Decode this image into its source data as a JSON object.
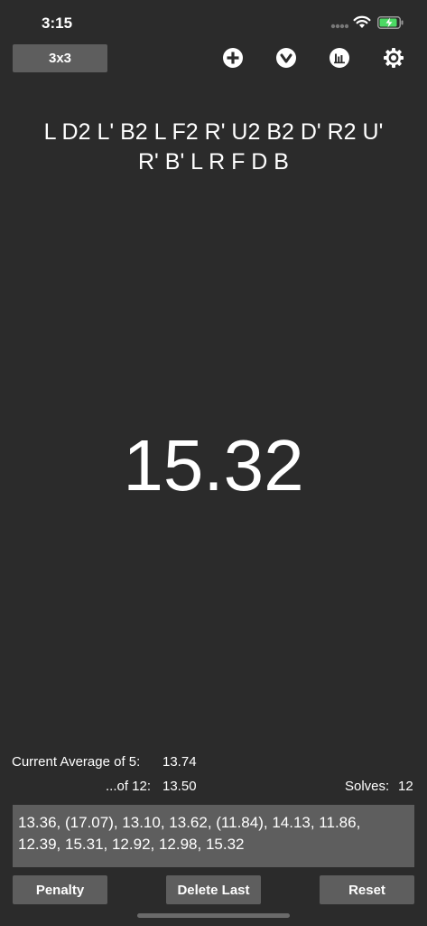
{
  "status_bar": {
    "time": "3:15"
  },
  "toolbar": {
    "puzzle_label": "3x3"
  },
  "scramble": {
    "line1": "L D2 L' B2 L F2 R' U2 B2 D' R2 U'",
    "line2": "R' B' L R F D B"
  },
  "timer": {
    "value": "15.32"
  },
  "stats": {
    "ao5_label": "Current Average of 5:",
    "ao5_value": "13.74",
    "ao12_label": "...of 12:",
    "ao12_value": "13.50",
    "solves_label": "Solves:",
    "solves_value": "12"
  },
  "times": {
    "line1": "13.36, (17.07), 13.10, 13.62, (11.84), 14.13, 11.86,",
    "line2": "12.39, 15.31, 12.92, 12.98, 15.32"
  },
  "actions": {
    "penalty_label": "Penalty",
    "delete_label": "Delete Last",
    "reset_label": "Reset"
  },
  "colors": {
    "background": "#2b2b2b",
    "button": "#5e5e5e",
    "battery": "#4cd964"
  },
  "icons": [
    "signal-icon",
    "wifi-icon",
    "battery-charging-icon",
    "plus-circle-icon",
    "chevron-down-circle-icon",
    "stats-icon",
    "gear-icon"
  ]
}
